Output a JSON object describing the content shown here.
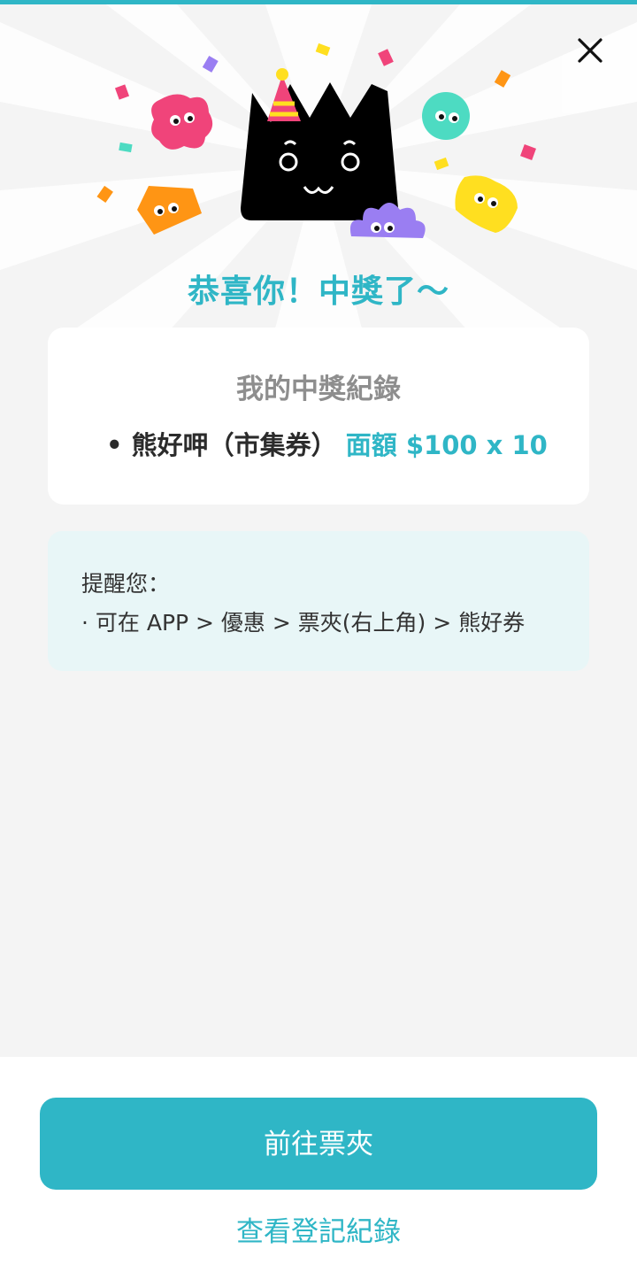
{
  "colors": {
    "accent": "#2fb6c6",
    "background": "#f4f4f4",
    "card": "#ffffff",
    "reminder_bg": "#e8f6f7",
    "mascot_black": "#000000",
    "pink": "#f0447a",
    "teal": "#4ddbc2",
    "orange": "#ff9514",
    "yellow": "#ffdf20",
    "purple": "#9a7ef2"
  },
  "header": {
    "close_icon": "close-icon",
    "title": "恭喜你！中獎了～"
  },
  "record_card": {
    "title": "我的中獎紀錄",
    "item_name": "• 熊好呷（市集券）",
    "item_value": "面額 $100 x 10"
  },
  "reminder": {
    "title": "提醒您：",
    "line": "· 可在 APP > 優惠 > 票夾(右上角) > 熊好券"
  },
  "footer": {
    "primary_button": "前往票夾",
    "secondary_link": "查看登記紀錄"
  }
}
